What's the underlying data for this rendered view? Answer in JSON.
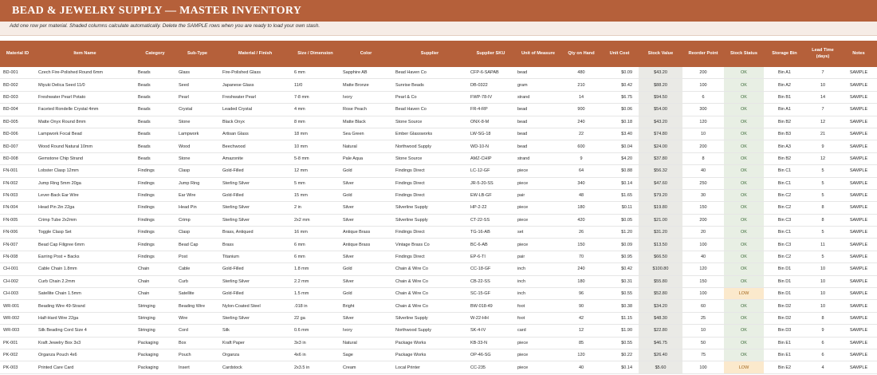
{
  "title": "BEAD & JEWELRY SUPPLY — MASTER INVENTORY",
  "subtitle": "Add one row per material. Shaded columns calculate automatically. Delete the SAMPLE rows when you are ready to load your own stash.",
  "columns": [
    "Material ID",
    "Item Name",
    "Category",
    "Sub-Type",
    "Material / Finish",
    "Size / Dimension",
    "Color",
    "Supplier",
    "Supplier SKU",
    "Unit of Measure",
    "Qty on Hand",
    "Unit Cost",
    "Stock Value",
    "Reorder Point",
    "Stock Status",
    "Storage Bin",
    "Lead Time (days)",
    "Notes"
  ],
  "colors": {
    "header_bg": "#b5603a",
    "calc_shade": "#eaeae6",
    "ok_shade": "#e8efe4",
    "low_shade": "#fbe9cc"
  },
  "rows": [
    [
      "BD-001",
      "Czech Fire-Polished Round 6mm",
      "Beads",
      "Glass",
      "Fire-Polished Glass",
      "6 mm",
      "Sapphire AB",
      "Bead Haven Co",
      "CFP-6-SAPAB",
      "bead",
      "480",
      "$0.09",
      "$43.20",
      "200",
      "OK",
      "Bin A1",
      "7",
      "SAMPLE"
    ],
    [
      "BD-002",
      "Miyuki Delica Seed 11/0",
      "Beads",
      "Seed",
      "Japanese Glass",
      "11/0",
      "Matte Bronze",
      "Sunrise Beads",
      "DB-0322",
      "gram",
      "210",
      "$0.42",
      "$88.20",
      "100",
      "OK",
      "Bin A2",
      "10",
      "SAMPLE"
    ],
    [
      "BD-003",
      "Freshwater Pearl Potato",
      "Beads",
      "Pearl",
      "Freshwater Pearl",
      "7-8 mm",
      "Ivory",
      "Pearl & Co",
      "FWP-78-IV",
      "strand",
      "14",
      "$6.75",
      "$94.50",
      "6",
      "OK",
      "Bin B1",
      "14",
      "SAMPLE"
    ],
    [
      "BD-004",
      "Faceted Rondelle Crystal 4mm",
      "Beads",
      "Crystal",
      "Leaded Crystal",
      "4 mm",
      "Rose Peach",
      "Bead Haven Co",
      "FR-4-RP",
      "bead",
      "900",
      "$0.06",
      "$54.00",
      "300",
      "OK",
      "Bin A1",
      "7",
      "SAMPLE"
    ],
    [
      "BD-005",
      "Matte Onyx Round 8mm",
      "Beads",
      "Stone",
      "Black Onyx",
      "8 mm",
      "Matte Black",
      "Stone Source",
      "ONX-8-M",
      "bead",
      "240",
      "$0.18",
      "$43.20",
      "120",
      "OK",
      "Bin B2",
      "12",
      "SAMPLE"
    ],
    [
      "BD-006",
      "Lampwork Focal Bead",
      "Beads",
      "Lampwork",
      "Artisan Glass",
      "18 mm",
      "Sea Green",
      "Ember Glassworks",
      "LW-SG-18",
      "bead",
      "22",
      "$3.40",
      "$74.80",
      "10",
      "OK",
      "Bin B3",
      "21",
      "SAMPLE"
    ],
    [
      "BD-007",
      "Wood Round Natural 10mm",
      "Beads",
      "Wood",
      "Beechwood",
      "10 mm",
      "Natural",
      "Northwood Supply",
      "WD-10-N",
      "bead",
      "600",
      "$0.04",
      "$24.00",
      "200",
      "OK",
      "Bin A3",
      "9",
      "SAMPLE"
    ],
    [
      "BD-008",
      "Gemstone Chip Strand",
      "Beads",
      "Stone",
      "Amazonite",
      "5-8 mm",
      "Pale Aqua",
      "Stone Source",
      "AMZ-CHIP",
      "strand",
      "9",
      "$4.20",
      "$37.80",
      "8",
      "OK",
      "Bin B2",
      "12",
      "SAMPLE"
    ],
    [
      "FN-001",
      "Lobster Clasp 12mm",
      "Findings",
      "Clasp",
      "Gold-Filled",
      "12 mm",
      "Gold",
      "Findings Direct",
      "LC-12-GF",
      "piece",
      "64",
      "$0.88",
      "$56.32",
      "40",
      "OK",
      "Bin C1",
      "5",
      "SAMPLE"
    ],
    [
      "FN-002",
      "Jump Ring 5mm 20ga",
      "Findings",
      "Jump Ring",
      "Sterling Silver",
      "5 mm",
      "Silver",
      "Findings Direct",
      "JR-5-20-SS",
      "piece",
      "340",
      "$0.14",
      "$47.60",
      "250",
      "OK",
      "Bin C1",
      "5",
      "SAMPLE"
    ],
    [
      "FN-003",
      "Lever-Back Ear Wire",
      "Findings",
      "Ear Wire",
      "Gold-Filled",
      "15 mm",
      "Gold",
      "Findings Direct",
      "EW-LB-GF",
      "pair",
      "48",
      "$1.65",
      "$79.20",
      "30",
      "OK",
      "Bin C2",
      "5",
      "SAMPLE"
    ],
    [
      "FN-004",
      "Head Pin 2in 22ga",
      "Findings",
      "Head Pin",
      "Sterling Silver",
      "2 in",
      "Silver",
      "Silverline Supply",
      "HP-2-22",
      "piece",
      "180",
      "$0.11",
      "$19.80",
      "150",
      "OK",
      "Bin C2",
      "8",
      "SAMPLE"
    ],
    [
      "FN-005",
      "Crimp Tube 2x2mm",
      "Findings",
      "Crimp",
      "Sterling Silver",
      "2x2 mm",
      "Silver",
      "Silverline Supply",
      "CT-22-SS",
      "piece",
      "420",
      "$0.05",
      "$21.00",
      "200",
      "OK",
      "Bin C3",
      "8",
      "SAMPLE"
    ],
    [
      "FN-006",
      "Toggle Clasp Set",
      "Findings",
      "Clasp",
      "Brass, Antiqued",
      "16 mm",
      "Antique Brass",
      "Findings Direct",
      "TG-16-AB",
      "set",
      "26",
      "$1.20",
      "$31.20",
      "20",
      "OK",
      "Bin C1",
      "5",
      "SAMPLE"
    ],
    [
      "FN-007",
      "Bead Cap Filigree 6mm",
      "Findings",
      "Bead Cap",
      "Brass",
      "6 mm",
      "Antique Brass",
      "Vintage Brass Co",
      "BC-6-AB",
      "piece",
      "150",
      "$0.09",
      "$13.50",
      "100",
      "OK",
      "Bin C3",
      "11",
      "SAMPLE"
    ],
    [
      "FN-008",
      "Earring Post + Backs",
      "Findings",
      "Post",
      "Titanium",
      "6 mm",
      "Silver",
      "Findings Direct",
      "EP-6-TI",
      "pair",
      "70",
      "$0.95",
      "$66.50",
      "40",
      "OK",
      "Bin C2",
      "5",
      "SAMPLE"
    ],
    [
      "CH-001",
      "Cable Chain 1.8mm",
      "Chain",
      "Cable",
      "Gold-Filled",
      "1.8 mm",
      "Gold",
      "Chain & Wire Co",
      "CC-18-GF",
      "inch",
      "240",
      "$0.42",
      "$100.80",
      "120",
      "OK",
      "Bin D1",
      "10",
      "SAMPLE"
    ],
    [
      "CH-002",
      "Curb Chain 2.2mm",
      "Chain",
      "Curb",
      "Sterling Silver",
      "2.2 mm",
      "Silver",
      "Chain & Wire Co",
      "CB-22-SS",
      "inch",
      "180",
      "$0.31",
      "$55.80",
      "150",
      "OK",
      "Bin D1",
      "10",
      "SAMPLE"
    ],
    [
      "CH-003",
      "Satellite Chain 1.5mm",
      "Chain",
      "Satellite",
      "Gold-Filled",
      "1.5 mm",
      "Gold",
      "Chain & Wire Co",
      "SC-15-GF",
      "inch",
      "96",
      "$0.55",
      "$52.80",
      "100",
      "LOW",
      "Bin D1",
      "10",
      "SAMPLE"
    ],
    [
      "WR-001",
      "Beading Wire 49-Strand",
      "Stringing",
      "Beading Wire",
      "Nylon-Coated Steel",
      ".018 in",
      "Bright",
      "Chain & Wire Co",
      "BW-018-49",
      "foot",
      "90",
      "$0.38",
      "$34.20",
      "60",
      "OK",
      "Bin D2",
      "10",
      "SAMPLE"
    ],
    [
      "WR-002",
      "Half-Hard Wire 22ga",
      "Stringing",
      "Wire",
      "Sterling Silver",
      "22 ga",
      "Silver",
      "Silverline Supply",
      "W-22-HH",
      "foot",
      "42",
      "$1.15",
      "$48.30",
      "25",
      "OK",
      "Bin D2",
      "8",
      "SAMPLE"
    ],
    [
      "WR-003",
      "Silk Beading Cord Size 4",
      "Stringing",
      "Cord",
      "Silk",
      "0.6 mm",
      "Ivory",
      "Northwood Supply",
      "SK-4-IV",
      "card",
      "12",
      "$1.90",
      "$22.80",
      "10",
      "OK",
      "Bin D3",
      "9",
      "SAMPLE"
    ],
    [
      "PK-001",
      "Kraft Jewelry Box 3x3",
      "Packaging",
      "Box",
      "Kraft Paper",
      "3x3 in",
      "Natural",
      "Package Works",
      "KB-33-N",
      "piece",
      "85",
      "$0.55",
      "$46.75",
      "50",
      "OK",
      "Bin E1",
      "6",
      "SAMPLE"
    ],
    [
      "PK-002",
      "Organza Pouch 4x6",
      "Packaging",
      "Pouch",
      "Organza",
      "4x6 in",
      "Sage",
      "Package Works",
      "OP-46-SG",
      "piece",
      "120",
      "$0.22",
      "$26.40",
      "75",
      "OK",
      "Bin E1",
      "6",
      "SAMPLE"
    ],
    [
      "PK-003",
      "Printed Care Card",
      "Packaging",
      "Insert",
      "Cardstock",
      "2x3.5 in",
      "Cream",
      "Local Printer",
      "CC-235",
      "piece",
      "40",
      "$0.14",
      "$5.60",
      "100",
      "LOW",
      "Bin E2",
      "4",
      "SAMPLE"
    ]
  ]
}
